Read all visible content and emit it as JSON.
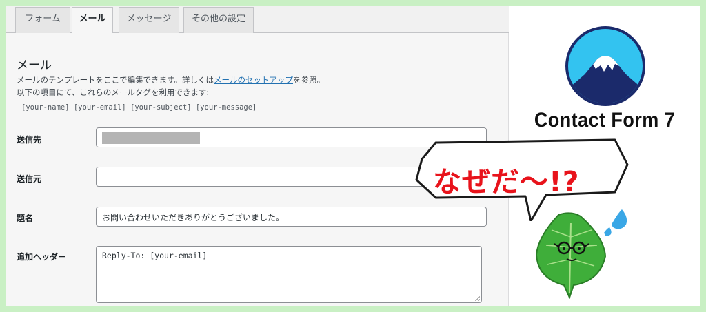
{
  "tabs": [
    {
      "label": "フォーム",
      "active": false
    },
    {
      "label": "メール",
      "active": true
    },
    {
      "label": "メッセージ",
      "active": false
    },
    {
      "label": "その他の設定",
      "active": false
    }
  ],
  "panel": {
    "title": "メール",
    "desc_line1_prefix": "メールのテンプレートをここで編集できます。詳しくは",
    "desc_link": "メールのセットアップ",
    "desc_line1_suffix": "を参照。",
    "desc_line2": "以下の項目にて、これらのメールタグを利用できます:",
    "mail_tags": "[your-name] [your-email] [your-subject] [your-message]"
  },
  "fields": {
    "to_label": "送信先",
    "to_value": "",
    "from_label": "送信元",
    "from_value": "",
    "subject_label": "題名",
    "subject_value": "お問い合わせいただきありがとうございました。",
    "headers_label": "追加ヘッダー",
    "headers_value": "Reply-To: [your-email]"
  },
  "side": {
    "brand": "Contact Form 7",
    "bubble": "なぜだ〜!?"
  },
  "colors": {
    "link": "#2271b1",
    "bubble_text": "#e8131b",
    "logo_sky": "#33c3f0",
    "logo_mountain": "#1b2a6b",
    "leaf": "#3fae3a",
    "background": "#c9f0c4"
  }
}
